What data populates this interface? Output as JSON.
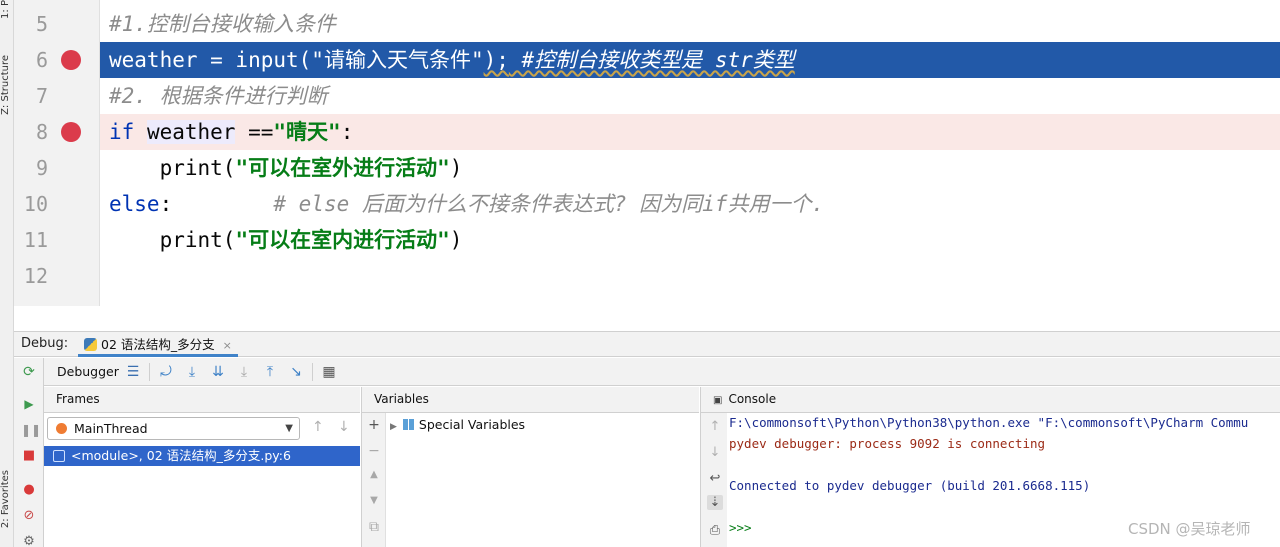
{
  "left_strip": {
    "tabs": [
      "1: P",
      "Z: Structure",
      "2: Favorites"
    ]
  },
  "editor": {
    "lines": [
      {
        "num": "5",
        "comment": "#1.控制台接收输入条件"
      },
      {
        "num": "6",
        "pre": "weather = input(",
        "str": "\"请输入天气条件\"",
        "post": ");",
        "comment": " #控制台接收类型是 str类型"
      },
      {
        "num": "7",
        "comment": "#2. 根据条件进行判断"
      },
      {
        "num": "8",
        "kw": "if",
        "word": "weather",
        "mid": " ==",
        "str": "\"晴天\"",
        "post": ":"
      },
      {
        "num": "9",
        "pre": "    print(",
        "str": "\"可以在室外进行活动\"",
        "post": ")"
      },
      {
        "num": "10",
        "kw": "else",
        "post": ":",
        "comment": "        # else 后面为什么不接条件表达式? 因为同if共用一个."
      },
      {
        "num": "11",
        "pre": "    print(",
        "str": "\"可以在室内进行活动\"",
        "post": ")"
      },
      {
        "num": "12"
      }
    ]
  },
  "debug": {
    "label": "Debug:",
    "tab_title": "02 语法结构_多分支",
    "tab_close": "×",
    "toolbar_tab": "Debugger",
    "frames_title": "Frames",
    "variables_title": "Variables",
    "console_title": "Console",
    "thread": "MainThread",
    "frame": "<module>, 02 语法结构_多分支.py:6",
    "special_variables": "Special Variables",
    "console_lines": [
      {
        "text": "F:\\commonsoft\\Python\\Python38\\python.exe \"F:\\commonsoft\\PyCharm Commu",
        "color": "blue"
      },
      {
        "text": "pydev debugger: process 9092 is connecting",
        "color": "red"
      },
      {
        "text": "",
        "color": "blue"
      },
      {
        "text": "Connected to pydev debugger (build 201.6668.115)",
        "color": "blue"
      },
      {
        "text": "",
        "color": "blue"
      },
      {
        "text": ">>>",
        "color": "green"
      }
    ]
  },
  "watermark": "CSDN @吴琼老师",
  "colors": {
    "current_line": "#2259a8",
    "breakpoint": "#db3b4b",
    "breakpoint_line": "#fae8e6",
    "selected_frame": "#2f65ca"
  }
}
